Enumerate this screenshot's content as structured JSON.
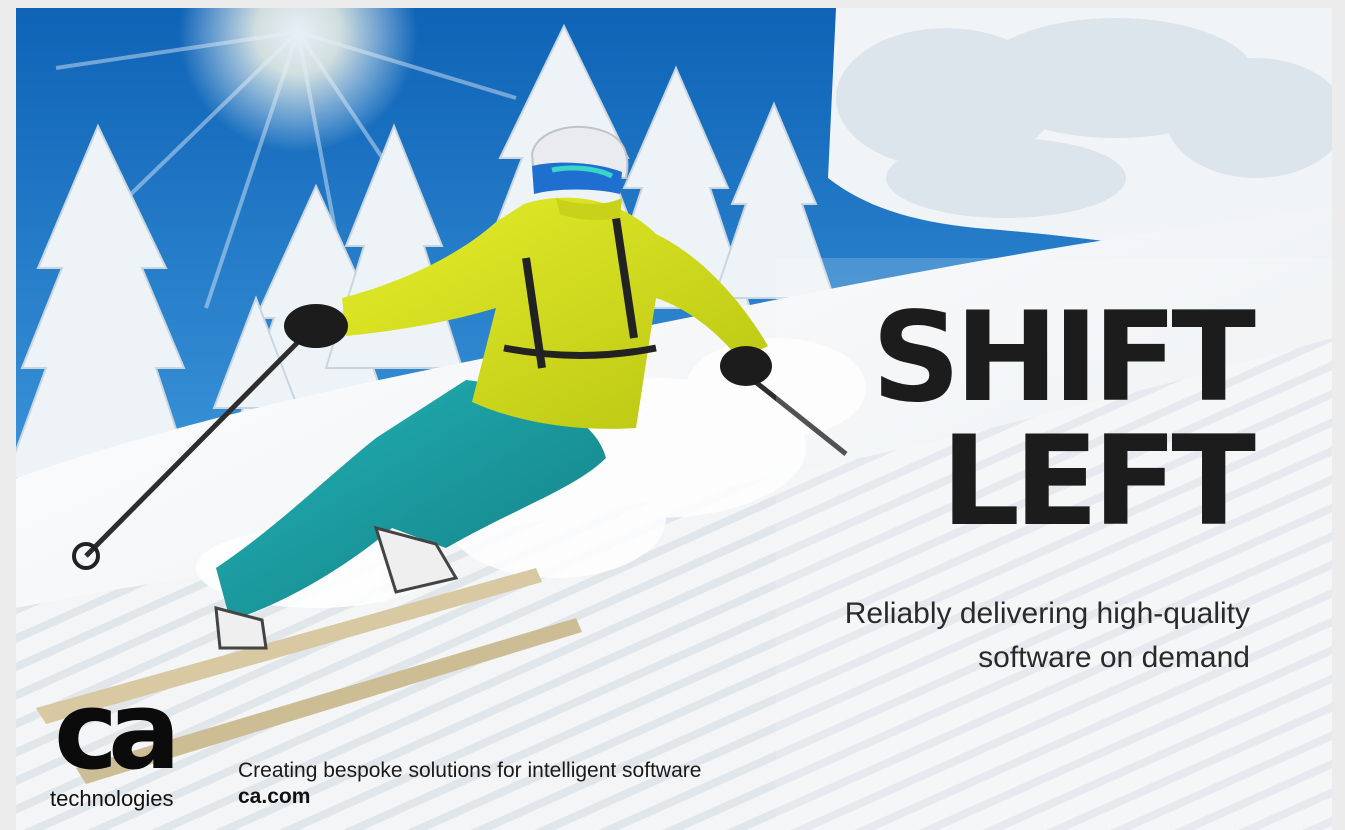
{
  "headline": {
    "line1": "SHIFT",
    "line2": "LEFT"
  },
  "tagline": {
    "line1": "Reliably delivering high-quality",
    "line2": "software on demand"
  },
  "logo": {
    "mark": "ca",
    "wordmark": "technologies"
  },
  "footer": {
    "text": "Creating bespoke solutions for intelligent software",
    "link": "ca.com"
  },
  "colors": {
    "sky": "#1a78c8",
    "jacket": "#d8e21c",
    "pants": "#1aa3a6",
    "text": "#1c1c1c"
  }
}
